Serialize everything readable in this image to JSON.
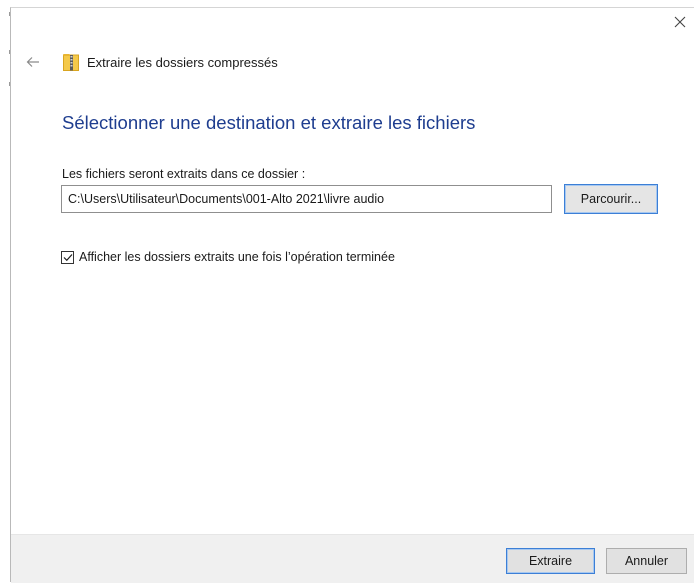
{
  "dialog": {
    "title": "Extraire les dossiers compressés",
    "heading": "Sélectionner une destination et extraire les fichiers",
    "destination_label": "Les fichiers seront extraits dans ce dossier :",
    "destination_path": "C:\\Users\\Utilisateur\\Documents\\001-Alto 2021\\livre audio",
    "browse_label": "Parcourir...",
    "show_extracted_label": "Afficher les dossiers extraits une fois l’opération terminée",
    "show_extracted_checked": true
  },
  "footer": {
    "extract_label": "Extraire",
    "cancel_label": "Annuler"
  },
  "icons": {
    "back": "back-arrow-icon",
    "title": "zip-folder-icon",
    "close": "close-icon",
    "check": "checkmark-icon"
  },
  "colors": {
    "heading": "#1e3d8f",
    "focus_border": "#3c7fd6",
    "footer_bg": "#f0f0f0"
  }
}
